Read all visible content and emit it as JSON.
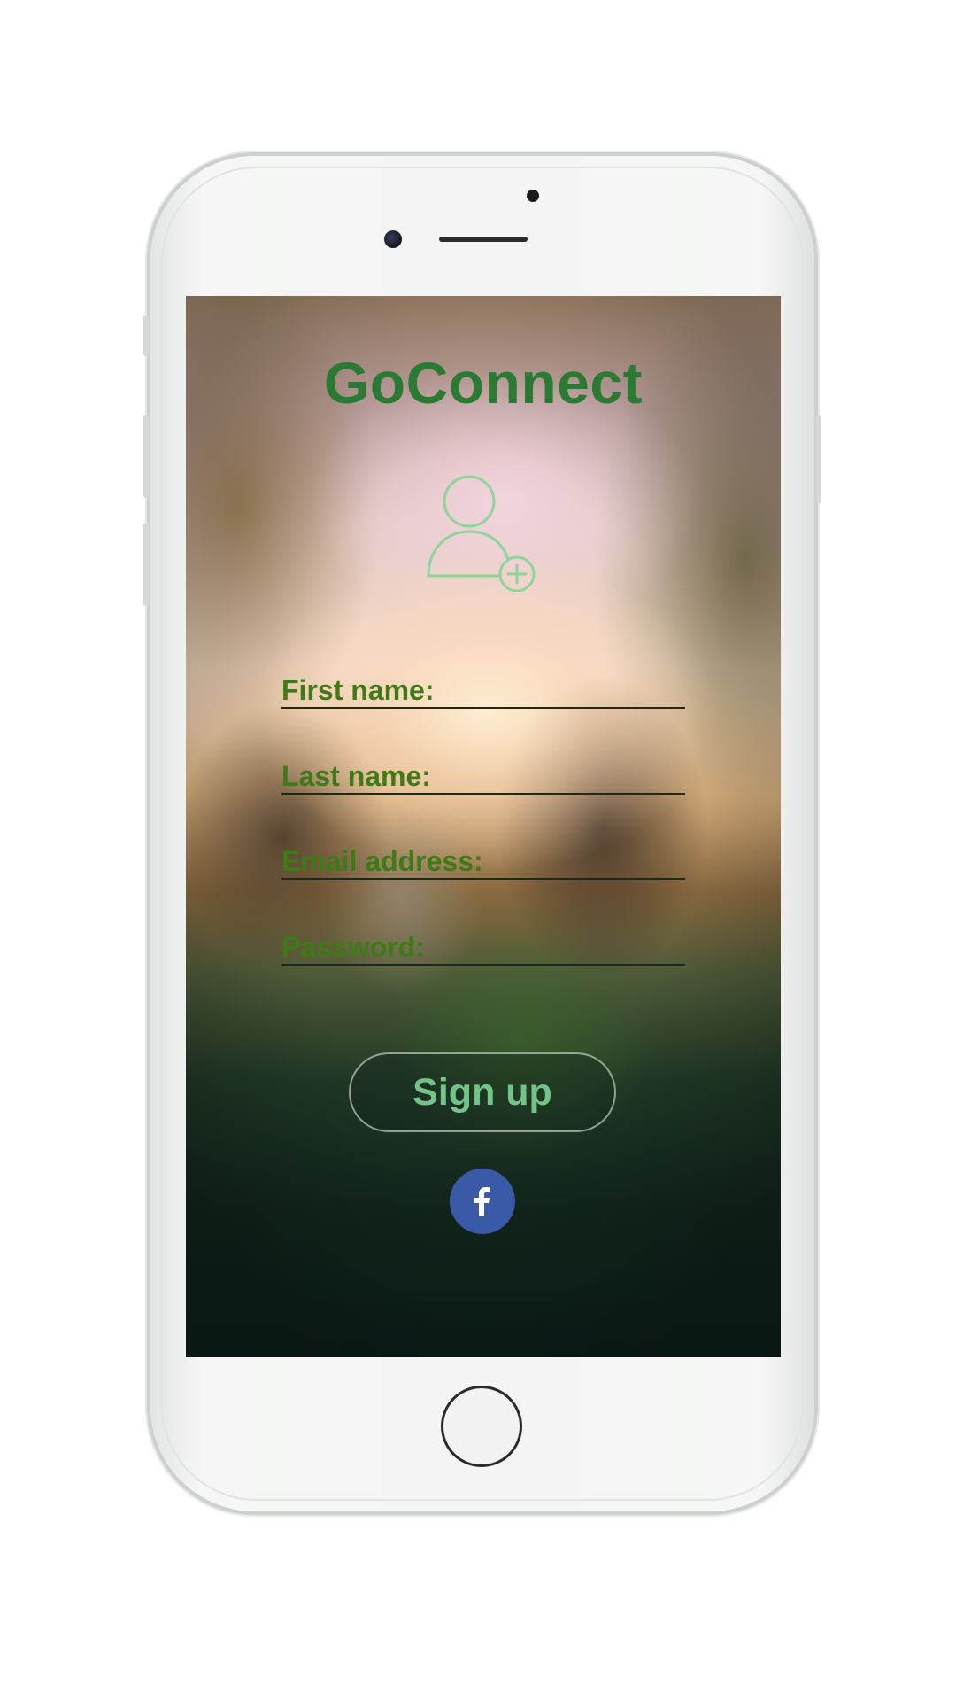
{
  "app": {
    "title": "GoConnect"
  },
  "signup_form": {
    "fields": [
      {
        "label": "First name:",
        "value": ""
      },
      {
        "label": "Last name:",
        "value": ""
      },
      {
        "label": "Email address:",
        "value": ""
      },
      {
        "label": "Password:",
        "value": ""
      }
    ],
    "submit_label": "Sign up"
  },
  "icons": {
    "header_icon": "add-user-icon",
    "social_icon": "facebook-icon"
  },
  "colors": {
    "title": "#2a7a33",
    "field_label": "#3e7a16",
    "button_text": "#74c48a",
    "facebook": "#3a5aa8"
  }
}
